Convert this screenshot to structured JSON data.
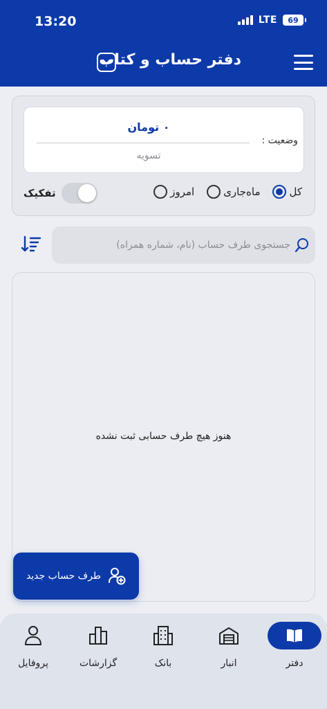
{
  "status_bar": {
    "time": "13:20",
    "network": "LTE",
    "battery": "69"
  },
  "header": {
    "title": "دفتر حساب و کتاب",
    "dropdown_icon": "chevron-down-icon",
    "menu_icon": "hamburger-menu-icon"
  },
  "summary": {
    "status_label": "وضعیت :",
    "amount": "۰ تومان",
    "state": "تسویه"
  },
  "filters": {
    "options": [
      {
        "label": "امروز",
        "checked": false
      },
      {
        "label": "ماه‌جاری",
        "checked": false
      },
      {
        "label": "کل",
        "checked": true
      }
    ],
    "toggle_label": "تفکیک",
    "toggle_on": false
  },
  "search": {
    "placeholder": "جستجوی طرف حساب (نام، شماره همراه)",
    "value": ""
  },
  "list": {
    "empty_message": "هنوز هیچ طرف حسابی ثبت نشده"
  },
  "fab": {
    "label": "طرف حساب جدید",
    "icon": "add-user-icon"
  },
  "bottom_nav": {
    "items": [
      {
        "label": "دفتر",
        "icon": "book-icon",
        "active": true
      },
      {
        "label": "انبار",
        "icon": "warehouse-icon",
        "active": false
      },
      {
        "label": "بانک",
        "icon": "bank-building-icon",
        "active": false
      },
      {
        "label": "گزارشات",
        "icon": "bar-chart-icon",
        "active": false
      },
      {
        "label": "پروفایل",
        "icon": "user-icon",
        "active": false
      }
    ]
  },
  "colors": {
    "primary": "#0d3aa9",
    "background": "#eceef3",
    "nav_background": "#dfe3ec"
  }
}
